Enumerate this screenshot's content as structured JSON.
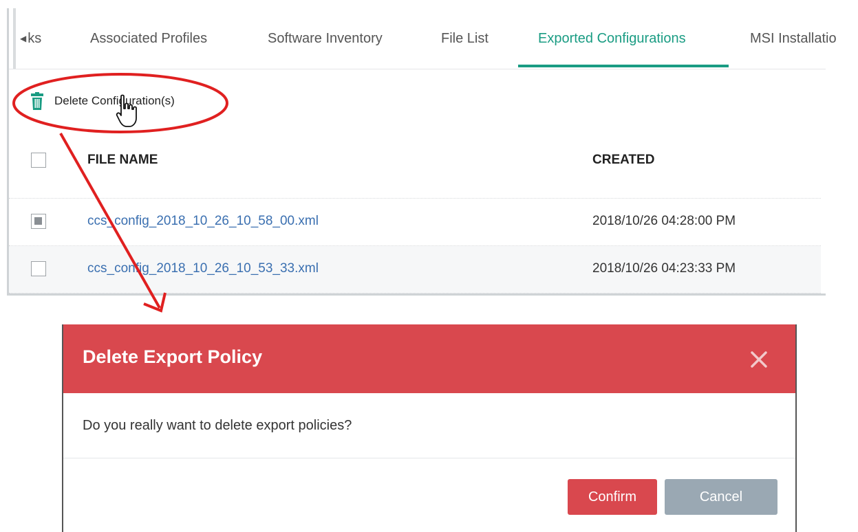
{
  "tabs": {
    "scroll_partial": "ks",
    "items": [
      {
        "label": "Associated Profiles",
        "active": false
      },
      {
        "label": "Software Inventory",
        "active": false
      },
      {
        "label": "File List",
        "active": false
      },
      {
        "label": "Exported Configurations",
        "active": true
      },
      {
        "label": "MSI Installatio",
        "active": false
      }
    ]
  },
  "toolbar": {
    "delete_label": "Delete Configuration(s)",
    "icon": "trash-icon"
  },
  "table": {
    "columns": [
      "FILE NAME",
      "CREATED"
    ],
    "rows": [
      {
        "file_name": "ccs_config_2018_10_26_10_58_00.xml",
        "created": "2018/10/26 04:28:00 PM",
        "checked": true
      },
      {
        "file_name": "ccs_config_2018_10_26_10_53_33.xml",
        "created": "2018/10/26 04:23:33 PM",
        "checked": false
      }
    ]
  },
  "modal": {
    "title": "Delete Export Policy",
    "message": "Do you really want to delete export policies?",
    "confirm_label": "Confirm",
    "cancel_label": "Cancel",
    "close_icon": "close-icon"
  },
  "colors": {
    "accent": "#1a9c83",
    "danger": "#d9484e",
    "link": "#3a6fb0",
    "cancel": "#9aa8b3",
    "annotation": "#e02020"
  }
}
